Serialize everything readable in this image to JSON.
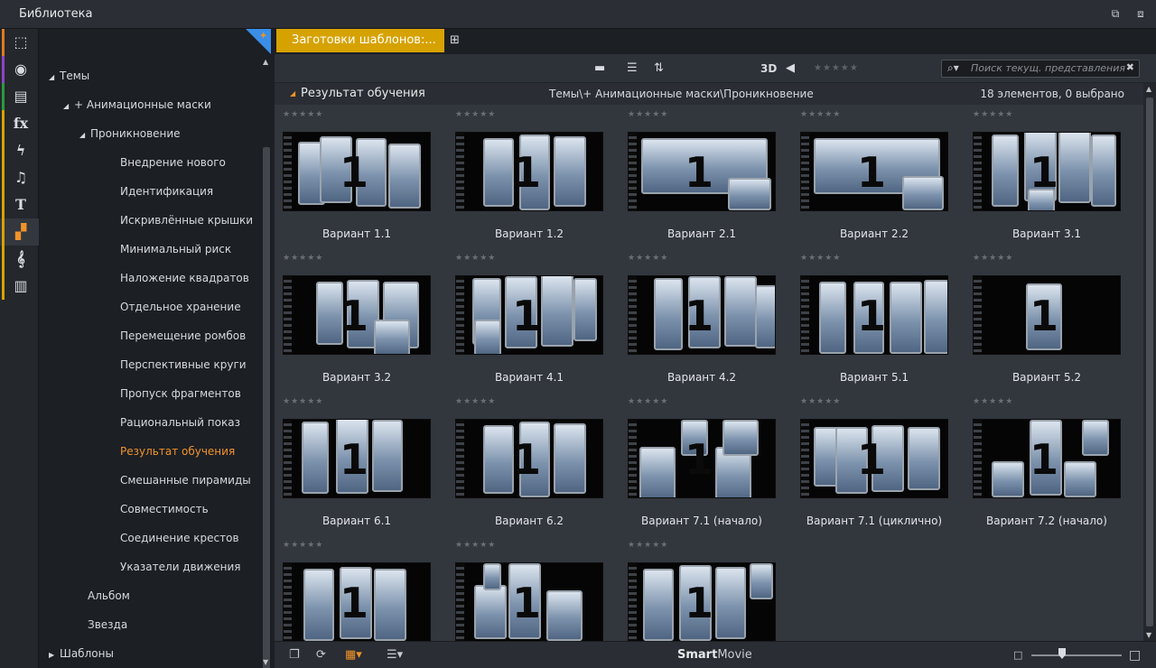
{
  "window": {
    "title": "Библиотека"
  },
  "sidebar_categories": [
    {
      "icon": "cube-stack-icon",
      "stripe": "#e07a1f",
      "glyph": "⬚"
    },
    {
      "icon": "film-reel-icon",
      "stripe": "#8e44c9",
      "glyph": "◉"
    },
    {
      "icon": "photo-stack-icon",
      "stripe": "#2b9a3c",
      "glyph": "▤"
    },
    {
      "icon": "fx-icon",
      "stripe": "#d6a200",
      "glyph": "fx"
    },
    {
      "icon": "lightning-icon",
      "stripe": "#d6a200",
      "glyph": "ϟ"
    },
    {
      "icon": "music-note-icon",
      "stripe": "#d6a200",
      "glyph": "♫"
    },
    {
      "icon": "text-t-icon",
      "stripe": "#d6a200",
      "glyph": "T"
    },
    {
      "icon": "montage-templates-icon",
      "stripe": "#d6a200",
      "glyph": "▞"
    },
    {
      "icon": "treble-clef-icon",
      "stripe": "#d6a200",
      "glyph": "𝄞"
    },
    {
      "icon": "piano-keys-icon",
      "stripe": "#d6a200",
      "glyph": "▥"
    }
  ],
  "tree": {
    "nodes": [
      {
        "label": "Темы",
        "arrow": "◢"
      },
      {
        "label": "+ Анимационные маски",
        "arrow": "◢"
      },
      {
        "label": "Проникновение",
        "arrow": "◢"
      },
      {
        "label": "Внедрение нового",
        "arrow": ""
      },
      {
        "label": "Идентификация",
        "arrow": ""
      },
      {
        "label": "Искривлённые крышки",
        "arrow": ""
      },
      {
        "label": "Минимальный риск",
        "arrow": ""
      },
      {
        "label": "Наложение квадратов",
        "arrow": ""
      },
      {
        "label": "Отдельное хранение",
        "arrow": ""
      },
      {
        "label": "Перемещение ромбов",
        "arrow": ""
      },
      {
        "label": "Перспективные круги",
        "arrow": ""
      },
      {
        "label": "Пропуск фрагментов",
        "arrow": ""
      },
      {
        "label": "Рациональный показ",
        "arrow": ""
      },
      {
        "label": "Результат обучения",
        "arrow": "",
        "selected": true
      },
      {
        "label": "Смешанные пирамиды",
        "arrow": ""
      },
      {
        "label": "Совместимость",
        "arrow": ""
      },
      {
        "label": "Соединение крестов",
        "arrow": ""
      },
      {
        "label": "Указатели движения",
        "arrow": ""
      },
      {
        "label": "Альбом",
        "arrow": ""
      },
      {
        "label": "Звезда",
        "arrow": ""
      },
      {
        "label": "Шаблоны",
        "arrow": "▶"
      }
    ]
  },
  "tab": {
    "label": "Заготовки шаблонов:..."
  },
  "toolbar": {
    "three_d": "3D",
    "rating_stars": "★★★★★",
    "search_placeholder": "Поиск текущ. представления"
  },
  "collection": {
    "name": "Результат обучения",
    "path": "Темы\\+ Анимационные маски\\Проникновение",
    "count": "18 элементов, 0 выбрано"
  },
  "items": [
    {
      "label": "Вариант 1.1",
      "stars": "★★★★★"
    },
    {
      "label": "Вариант 1.2",
      "stars": "★★★★★"
    },
    {
      "label": "Вариант 2.1",
      "stars": "★★★★★"
    },
    {
      "label": "Вариант 2.2",
      "stars": "★★★★★"
    },
    {
      "label": "Вариант 3.1",
      "stars": "★★★★★"
    },
    {
      "label": "Вариант 3.2",
      "stars": "★★★★★"
    },
    {
      "label": "Вариант 4.1",
      "stars": "★★★★★"
    },
    {
      "label": "Вариант 4.2",
      "stars": "★★★★★"
    },
    {
      "label": "Вариант 5.1",
      "stars": "★★★★★"
    },
    {
      "label": "Вариант 5.2",
      "stars": "★★★★★"
    },
    {
      "label": "Вариант 6.1",
      "stars": "★★★★★"
    },
    {
      "label": "Вариант 6.2",
      "stars": "★★★★★"
    },
    {
      "label": "Вариант 7.1 (начало)",
      "stars": "★★★★★"
    },
    {
      "label": "Вариант 7.1 (циклично)",
      "stars": "★★★★★"
    },
    {
      "label": "Вариант 7.2 (начало)",
      "stars": "★★★★★"
    },
    {
      "label": "",
      "stars": "★★★★★"
    },
    {
      "label": "",
      "stars": "★★★★★"
    },
    {
      "label": "",
      "stars": "★★★★★"
    }
  ],
  "thumb_digit": "1",
  "statusbar": {
    "smart": "Smart",
    "movie": "Movie"
  }
}
